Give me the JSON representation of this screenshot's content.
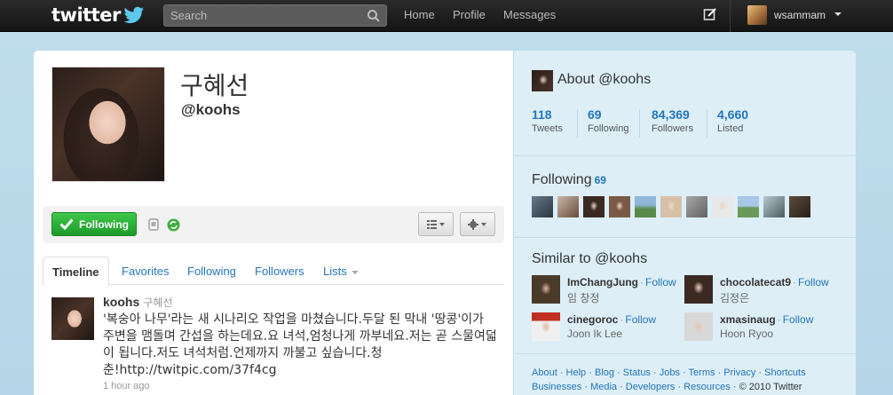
{
  "topbar": {
    "logo": "twitter",
    "search_placeholder": "Search",
    "nav": [
      "Home",
      "Profile",
      "Messages"
    ],
    "username": "wsammam"
  },
  "profile": {
    "fullname": "구혜선",
    "handle": "@koohs",
    "follow_label": "Following"
  },
  "tabs": [
    "Timeline",
    "Favorites",
    "Following",
    "Followers",
    "Lists"
  ],
  "tweet": {
    "user": "koohs",
    "realname": "구혜선",
    "text": "'복숭아 나무'라는 새 시나리오 작업을 마쳤습니다.두달 된 막내 '땅콩'이가 주변을 맴돌며 간섭을 하는데요.요 녀석,엄청나게 까부네요.저는 곧 스물여덟이 됩니다.저도 녀석처럼.언제까지 까불고 싶습니다.청춘!http://twitpic.com/37f4cg",
    "time": "1 hour ago"
  },
  "sidebar": {
    "about_title": "About @koohs",
    "stats": [
      {
        "num": "118",
        "label": "Tweets"
      },
      {
        "num": "69",
        "label": "Following"
      },
      {
        "num": "84,369",
        "label": "Followers"
      },
      {
        "num": "4,660",
        "label": "Listed"
      }
    ],
    "following_title": "Following",
    "following_count": "69",
    "similar_title": "Similar to @koohs",
    "similar": [
      {
        "name": "ImChangJung",
        "real": "임 창정",
        "follow": "Follow"
      },
      {
        "name": "chocolatecat9",
        "real": "김정은",
        "follow": "Follow"
      },
      {
        "name": "cinegoroc",
        "real": "Joon Ik Lee",
        "follow": "Follow"
      },
      {
        "name": "xmasinaug",
        "real": "Hoon Ryoo",
        "follow": "Follow"
      }
    ],
    "footer": {
      "links1": [
        "About",
        "Help",
        "Blog",
        "Status",
        "Jobs",
        "Terms",
        "Privacy",
        "Shortcuts"
      ],
      "links2": [
        "Businesses",
        "Media",
        "Developers",
        "Resources"
      ],
      "copyright": "© 2010 Twitter"
    }
  },
  "colors": {
    "link": "#2276bb",
    "follow_green": "#2ea83a",
    "background": "#c0deed",
    "sidebar": "#ddeef6"
  }
}
